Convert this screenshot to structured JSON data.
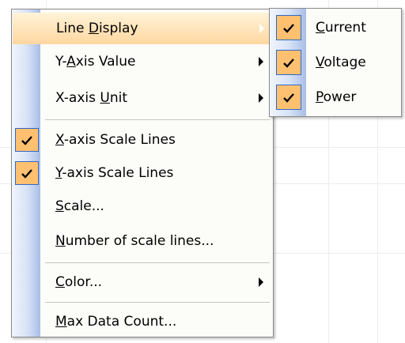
{
  "main_menu": {
    "items": [
      {
        "label_pre": "Line ",
        "label_u": "D",
        "label_post": "isplay",
        "checked": false,
        "submenu": true
      },
      {
        "label_pre": "Y-",
        "label_u": "A",
        "label_post": "xis Value",
        "checked": false,
        "submenu": true
      },
      {
        "label_pre": "X-axis ",
        "label_u": "U",
        "label_post": "nit",
        "checked": false,
        "submenu": true
      },
      {
        "label_pre": "",
        "label_u": "X",
        "label_post": "-axis Scale Lines",
        "checked": true,
        "submenu": false
      },
      {
        "label_pre": "",
        "label_u": "Y",
        "label_post": "-axis Scale Lines",
        "checked": true,
        "submenu": false
      },
      {
        "label_pre": "",
        "label_u": "S",
        "label_post": "cale...",
        "checked": false,
        "submenu": false
      },
      {
        "label_pre": "",
        "label_u": "N",
        "label_post": "umber of scale lines...",
        "checked": false,
        "submenu": false
      },
      {
        "label_pre": "",
        "label_u": "C",
        "label_post": "olor...",
        "checked": false,
        "submenu": true
      },
      {
        "label_pre": "",
        "label_u": "M",
        "label_post": "ax Data Count...",
        "checked": false,
        "submenu": false
      }
    ]
  },
  "sub_menu": {
    "items": [
      {
        "label_pre": "",
        "label_u": "C",
        "label_post": "urrent",
        "checked": true
      },
      {
        "label_pre": "",
        "label_u": "V",
        "label_post": "oltage",
        "checked": true
      },
      {
        "label_pre": "",
        "label_u": "P",
        "label_post": "ower",
        "checked": true
      }
    ]
  },
  "colors": {
    "highlight_top": "#fff3d8",
    "highlight_bottom": "#ffd7a0",
    "check_background": "#ffc070",
    "check_border": "#316ac5",
    "gutter_dark": "#a9bde5"
  }
}
